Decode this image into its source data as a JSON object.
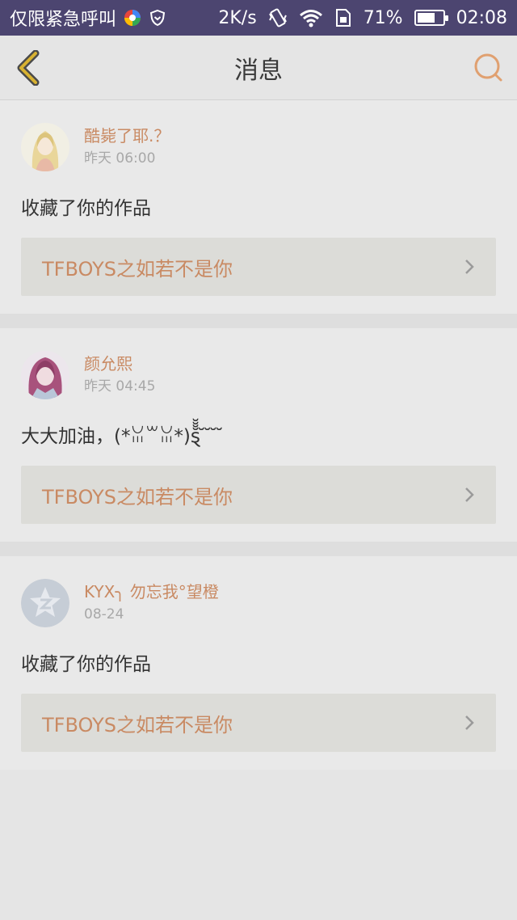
{
  "status_bar": {
    "carrier": "仅限紧急呼叫",
    "speed": "2K/s",
    "battery_percent": "71%",
    "battery_level": 0.71,
    "time": "02:08"
  },
  "header": {
    "title": "消息"
  },
  "colors": {
    "accent": "#c98a63",
    "status_bar_bg": "#4c4570",
    "page_bg": "#e5e5e5"
  },
  "messages": [
    {
      "username": "酷毙了耶.？",
      "time": "昨天 06:00",
      "content": "收藏了你的作品",
      "work_title": "TFBOYS之如若不是你",
      "avatar": "anime-girl-blonde-avatar"
    },
    {
      "username": "颜允熙",
      "time": "昨天 04:45",
      "content": "大大加油，(*ꈍ꒳ꈍ*)ȿ̆̆̆̆ ̆ ̆ ̆ ̆ ",
      "work_title": "TFBOYS之如若不是你",
      "avatar": "anime-girl-pink-avatar"
    },
    {
      "username": "KYX╮ 勿忘我°望橙",
      "time": "08-24",
      "content": "收藏了你的作品",
      "work_title": "TFBOYS之如若不是你",
      "avatar": "default-star-avatar"
    }
  ]
}
